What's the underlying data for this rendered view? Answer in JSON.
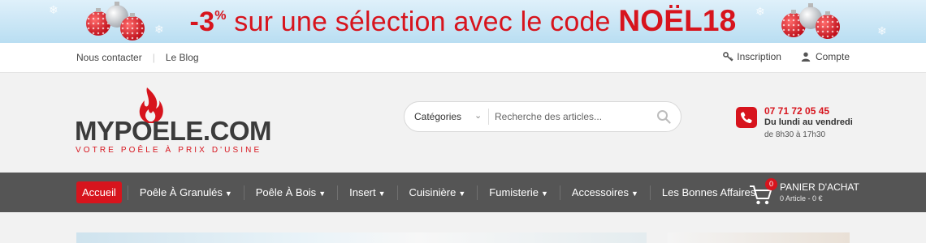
{
  "promo": {
    "discount": "-3",
    "percent": "%",
    "text": " sur une sélection avec le code ",
    "code": "NOËL18"
  },
  "topbar": {
    "contact": "Nous contacter",
    "blog": "Le Blog",
    "signup": "Inscription",
    "account": "Compte"
  },
  "logo": {
    "name": "MYPOELE.COM",
    "tagline": "VOTRE POÊLE À PRIX D'USINE"
  },
  "search": {
    "category": "Catégories",
    "placeholder": "Recherche des articles..."
  },
  "contact": {
    "phone": "07 71 72 05 45",
    "days": "Du lundi au vendredi",
    "hours": "de 8h30 à 17h30"
  },
  "nav": {
    "items": [
      {
        "label": "Accueil"
      },
      {
        "label": "Poêle À Granulés"
      },
      {
        "label": "Poêle À Bois"
      },
      {
        "label": "Insert"
      },
      {
        "label": "Cuisinière"
      },
      {
        "label": "Fumisterie"
      },
      {
        "label": "Accessoires"
      },
      {
        "label": "Les Bonnes Affaires"
      }
    ]
  },
  "cart": {
    "count": "0",
    "title": "PANIER D'ACHAT",
    "summary": "0 Article - 0 €"
  },
  "colors": {
    "accent": "#d7141d",
    "nav_bg": "#555555",
    "header_bg": "#f2f2f2"
  }
}
